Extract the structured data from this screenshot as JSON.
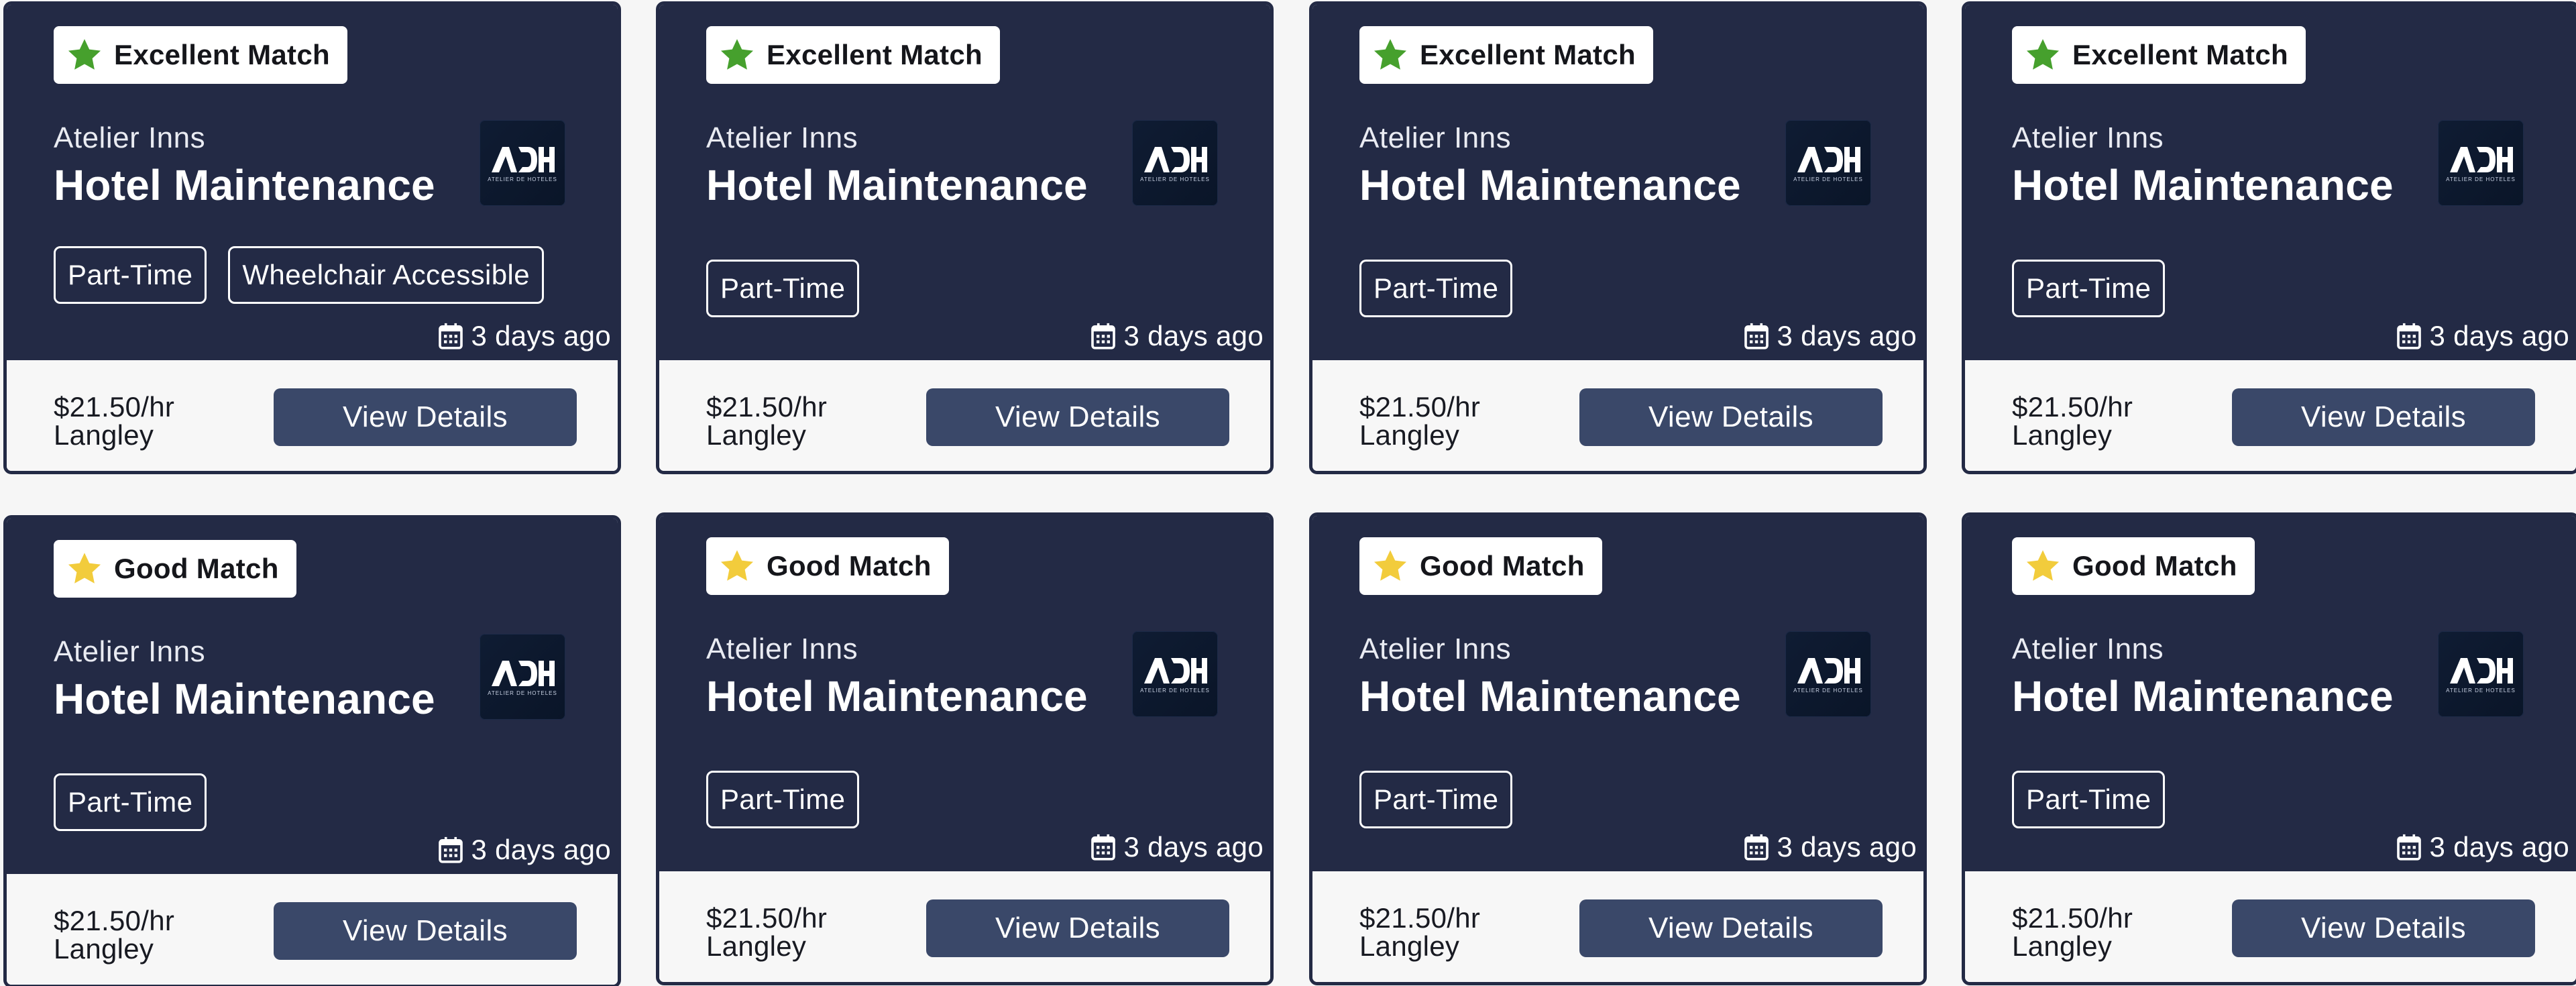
{
  "colors": {
    "card_header_bg": "#232a45",
    "card_footer_bg": "#f7f7f7",
    "button_bg": "#3a4869",
    "excellent_star": "#46a02d",
    "good_star": "#f2cc3c"
  },
  "cards": [
    {
      "badge": {
        "label": "Excellent Match",
        "level": "excellent",
        "icon": "star-icon"
      },
      "company": "Atelier Inns",
      "title": "Hotel Maintenance",
      "logo_text": "ADH",
      "logo_subtext": "ATELIER DE HOTELES",
      "tags": [
        "Part-Time",
        "Wheelchair Accessible"
      ],
      "posted": "3 days ago",
      "pay": "$21.50/hr",
      "location": "Langley",
      "button_label": "View Details"
    },
    {
      "badge": {
        "label": "Excellent Match",
        "level": "excellent",
        "icon": "star-icon"
      },
      "company": "Atelier Inns",
      "title": "Hotel Maintenance",
      "logo_text": "ADH",
      "logo_subtext": "ATELIER DE HOTELES",
      "tags": [
        "Part-Time"
      ],
      "posted": "3 days ago",
      "pay": "$21.50/hr",
      "location": "Langley",
      "button_label": "View Details"
    },
    {
      "badge": {
        "label": "Excellent Match",
        "level": "excellent",
        "icon": "star-icon"
      },
      "company": "Atelier Inns",
      "title": "Hotel Maintenance",
      "logo_text": "ADH",
      "logo_subtext": "ATELIER DE HOTELES",
      "tags": [
        "Part-Time"
      ],
      "posted": "3 days ago",
      "pay": "$21.50/hr",
      "location": "Langley",
      "button_label": "View Details"
    },
    {
      "badge": {
        "label": "Excellent Match",
        "level": "excellent",
        "icon": "star-icon"
      },
      "company": "Atelier Inns",
      "title": "Hotel Maintenance",
      "logo_text": "ADH",
      "logo_subtext": "ATELIER DE HOTELES",
      "tags": [
        "Part-Time"
      ],
      "posted": "3 days ago",
      "pay": "$21.50/hr",
      "location": "Langley",
      "button_label": "View Details"
    },
    {
      "badge": {
        "label": "Good Match",
        "level": "good",
        "icon": "star-icon"
      },
      "company": "Atelier Inns",
      "title": "Hotel Maintenance",
      "logo_text": "ADH",
      "logo_subtext": "ATELIER DE HOTELES",
      "tags": [
        "Part-Time"
      ],
      "posted": "3 days ago",
      "pay": "$21.50/hr",
      "location": "Langley",
      "button_label": "View Details"
    },
    {
      "badge": {
        "label": "Good Match",
        "level": "good",
        "icon": "star-icon"
      },
      "company": "Atelier Inns",
      "title": "Hotel Maintenance",
      "logo_text": "ADH",
      "logo_subtext": "ATELIER DE HOTELES",
      "tags": [
        "Part-Time"
      ],
      "posted": "3 days ago",
      "pay": "$21.50/hr",
      "location": "Langley",
      "button_label": "View Details"
    },
    {
      "badge": {
        "label": "Good Match",
        "level": "good",
        "icon": "star-icon"
      },
      "company": "Atelier Inns",
      "title": "Hotel Maintenance",
      "logo_text": "ADH",
      "logo_subtext": "ATELIER DE HOTELES",
      "tags": [
        "Part-Time"
      ],
      "posted": "3 days ago",
      "pay": "$21.50/hr",
      "location": "Langley",
      "button_label": "View Details"
    },
    {
      "badge": {
        "label": "Good Match",
        "level": "good",
        "icon": "star-icon"
      },
      "company": "Atelier Inns",
      "title": "Hotel Maintenance",
      "logo_text": "ADH",
      "logo_subtext": "ATELIER DE HOTELES",
      "tags": [
        "Part-Time"
      ],
      "posted": "3 days ago",
      "pay": "$21.50/hr",
      "location": "Langley",
      "button_label": "View Details"
    }
  ]
}
